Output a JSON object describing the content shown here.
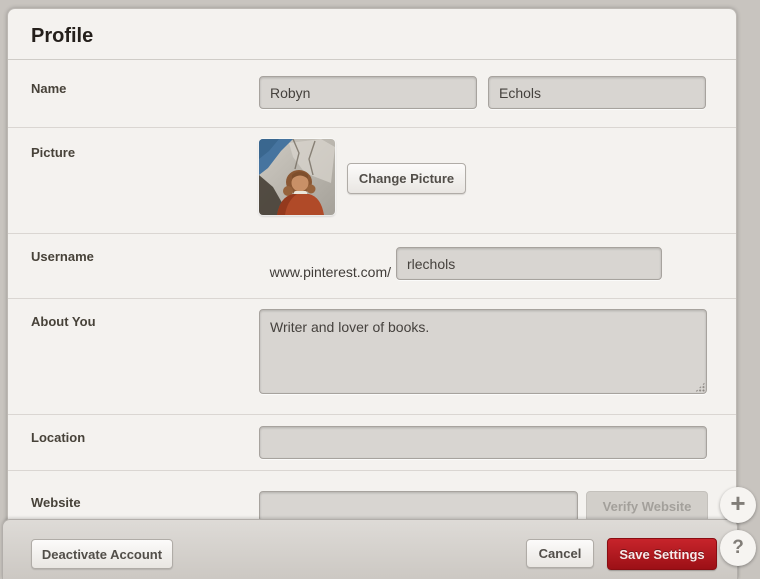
{
  "header": {
    "title": "Profile"
  },
  "fields": {
    "name": {
      "label": "Name",
      "first_value": "Robyn",
      "last_value": "Echols"
    },
    "picture": {
      "label": "Picture",
      "change_button": "Change Picture"
    },
    "username": {
      "label": "Username",
      "url_prefix": "www.pinterest.com/",
      "value": "rlechols"
    },
    "about": {
      "label": "About You",
      "value": "Writer and lover of books."
    },
    "location": {
      "label": "Location",
      "value": ""
    },
    "website": {
      "label": "Website",
      "value": "",
      "verify_button": "Verify Website"
    }
  },
  "footer": {
    "deactivate_button": "Deactivate Account",
    "cancel_button": "Cancel",
    "save_button": "Save Settings"
  },
  "floating": {
    "plus": "+",
    "help": "?"
  },
  "colors": {
    "accent_red": "#b3161c",
    "page_background": "#c8c4bf",
    "panel_background": "#f4f2ef",
    "input_background": "#d8d5d1"
  }
}
